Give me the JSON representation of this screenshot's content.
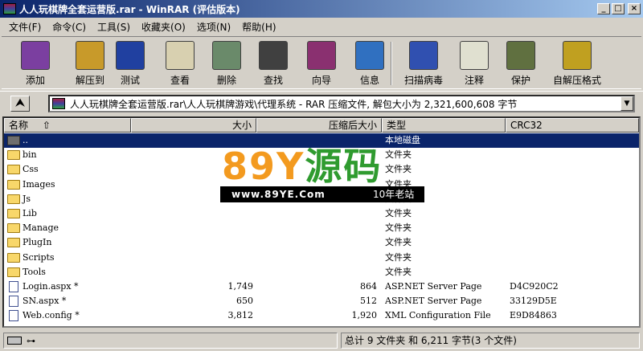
{
  "window": {
    "title": "人人玩棋牌全套运营版.rar - WinRAR (评估版本)",
    "minimize": "_",
    "maximize": "□",
    "close": "×"
  },
  "menu": [
    "文件(F)",
    "命令(C)",
    "工具(S)",
    "收藏夹(O)",
    "选项(N)",
    "帮助(H)"
  ],
  "toolbar": [
    {
      "label": "添加",
      "icon": "add-books-icon",
      "color": "#7b3fa0"
    },
    {
      "label": "解压到",
      "icon": "extract-folder-icon",
      "color": "#c89a2a"
    },
    {
      "label": "测试",
      "icon": "test-check-icon",
      "color": "#2040a0"
    },
    {
      "label": "查看",
      "icon": "view-glasses-icon",
      "color": "#d8d0b0"
    },
    {
      "label": "删除",
      "icon": "delete-recycle-icon",
      "color": "#6a8a6a"
    },
    {
      "label": "查找",
      "icon": "find-binoculars-icon",
      "color": "#404040"
    },
    {
      "label": "向导",
      "icon": "wizard-icon",
      "color": "#8a3070"
    },
    {
      "label": "信息",
      "icon": "info-icon",
      "color": "#3070c0"
    },
    {
      "label": "扫描病毒",
      "icon": "virus-scan-icon",
      "color": "#3050b0"
    },
    {
      "label": "注释",
      "icon": "comment-icon",
      "color": "#e0e0d0"
    },
    {
      "label": "保护",
      "icon": "protect-shield-icon",
      "color": "#607040"
    },
    {
      "label": "自解压格式",
      "icon": "sfx-icon",
      "color": "#c0a020"
    }
  ],
  "address": {
    "path": "人人玩棋牌全套运营版.rar\\人人玩棋牌游戏\\代理系统 - RAR 压缩文件, 解包大小为 2,321,600,608 字节",
    "up_glyph": "⮝",
    "drop_glyph": "▼"
  },
  "columns": {
    "name": "名称",
    "sort_glyph": "⇧",
    "size": "大小",
    "packed": "压缩后大小",
    "type": "类型",
    "crc": "CRC32"
  },
  "files": [
    {
      "name": "..",
      "size": "",
      "packed": "",
      "type": "本地磁盘",
      "crc": "",
      "kind": "up",
      "selected": true
    },
    {
      "name": "bin",
      "size": "",
      "packed": "",
      "type": "文件夹",
      "crc": "",
      "kind": "folder"
    },
    {
      "name": "Css",
      "size": "",
      "packed": "",
      "type": "文件夹",
      "crc": "",
      "kind": "folder"
    },
    {
      "name": "Images",
      "size": "",
      "packed": "",
      "type": "文件夹",
      "crc": "",
      "kind": "folder"
    },
    {
      "name": "Js",
      "size": "",
      "packed": "",
      "type": "文件夹",
      "crc": "",
      "kind": "folder"
    },
    {
      "name": "Lib",
      "size": "",
      "packed": "",
      "type": "文件夹",
      "crc": "",
      "kind": "folder"
    },
    {
      "name": "Manage",
      "size": "",
      "packed": "",
      "type": "文件夹",
      "crc": "",
      "kind": "folder"
    },
    {
      "name": "PlugIn",
      "size": "",
      "packed": "",
      "type": "文件夹",
      "crc": "",
      "kind": "folder"
    },
    {
      "name": "Scripts",
      "size": "",
      "packed": "",
      "type": "文件夹",
      "crc": "",
      "kind": "folder"
    },
    {
      "name": "Tools",
      "size": "",
      "packed": "",
      "type": "文件夹",
      "crc": "",
      "kind": "folder"
    },
    {
      "name": "Login.aspx *",
      "size": "1,749",
      "packed": "864",
      "type": "ASP.NET Server Page",
      "crc": "D4C920C2",
      "kind": "file"
    },
    {
      "name": "SN.aspx *",
      "size": "650",
      "packed": "512",
      "type": "ASP.NET Server Page",
      "crc": "33129D5E",
      "kind": "file"
    },
    {
      "name": "Web.config *",
      "size": "3,812",
      "packed": "1,920",
      "type": "XML Configuration File",
      "crc": "E9D84863",
      "kind": "file"
    }
  ],
  "watermark": {
    "big_a": "89Y",
    "big_b": "源码",
    "url": "www.89YE.Com",
    "tag": "10年老站"
  },
  "status": {
    "key_glyph": "⊶",
    "summary": "总计 9 文件夹 和 6,211 字节(3 个文件)"
  }
}
